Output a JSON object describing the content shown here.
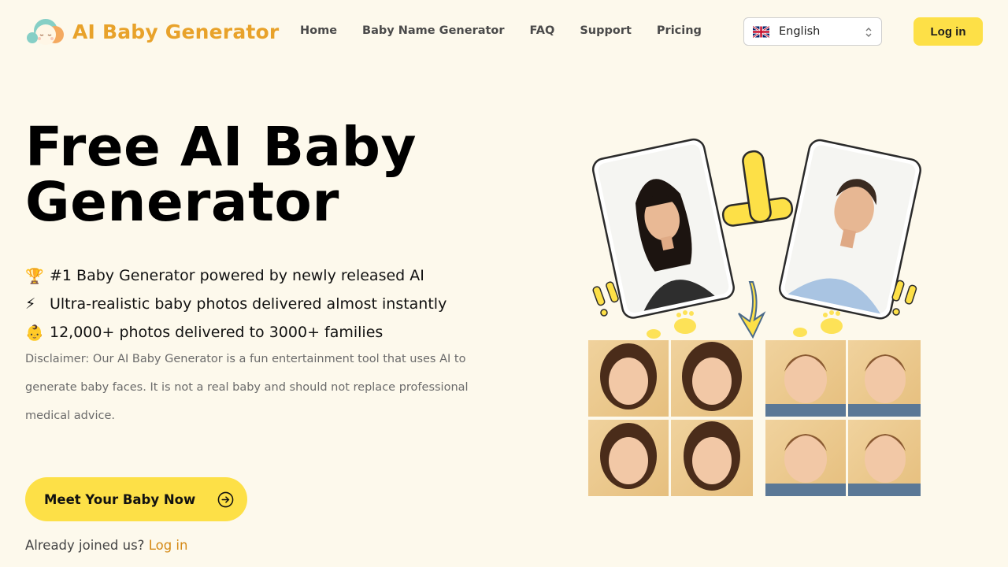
{
  "header": {
    "brand": "AI Baby Generator",
    "nav": [
      "Home",
      "Baby Name Generator",
      "FAQ",
      "Support",
      "Pricing"
    ],
    "language": {
      "selected": "English",
      "flag_icon": "uk-flag-icon"
    },
    "login_label": "Log in"
  },
  "hero": {
    "title_line1": "Free AI Baby",
    "title_line2": "Generator",
    "features": [
      {
        "icon": "🏆",
        "text": "#1 Baby Generator powered by newly released AI"
      },
      {
        "icon": "⚡",
        "text": "Ultra-realistic baby photos delivered almost instantly"
      },
      {
        "icon": "👶",
        "text": "12,000+ photos delivered to 3000+ families"
      }
    ],
    "disclaimer": "Disclaimer: Our AI Baby Generator is a fun entertainment tool that uses AI to generate baby faces. It is not a real baby and should not replace professional medical advice.",
    "cta_label": "Meet Your Baby Now",
    "joined_text": "Already joined us?",
    "joined_link": "Log in"
  },
  "colors": {
    "background": "#fdf9ec",
    "accent_yellow": "#fde047",
    "brand_orange": "#e8a22a",
    "link_orange": "#d58a17"
  }
}
